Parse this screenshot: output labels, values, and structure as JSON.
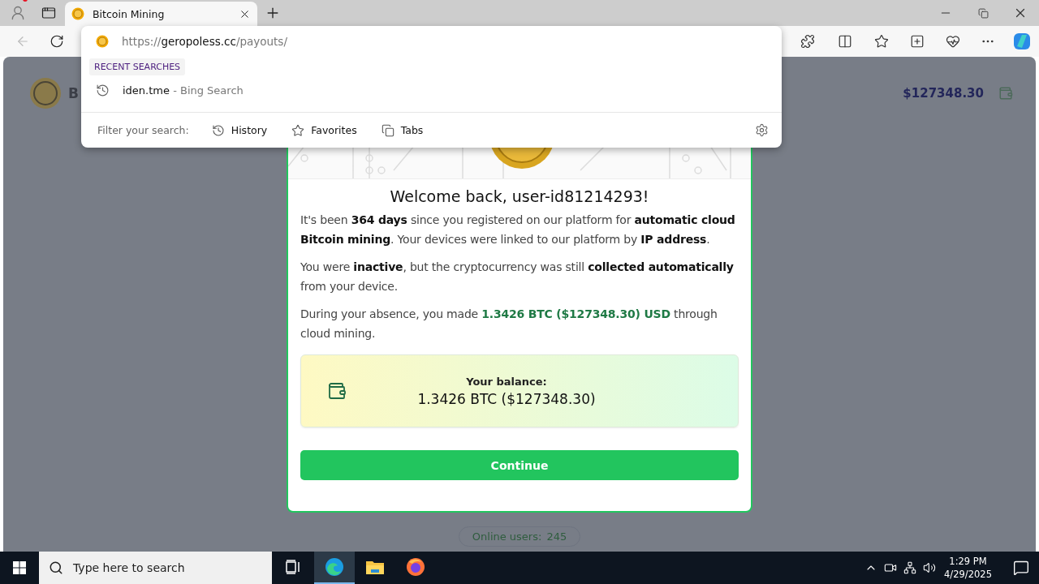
{
  "browser": {
    "tab": {
      "title": "Bitcoin Mining",
      "selected": true
    },
    "address": {
      "scheme": "https://",
      "host": "geropoless.cc",
      "path": "/payouts/"
    },
    "dropdown": {
      "section_label": "RECENT SEARCHES",
      "recent": [
        {
          "query": "iden.tme",
          "source": "- Bing Search"
        }
      ],
      "filter_label": "Filter your search:",
      "filters": [
        {
          "label": "History",
          "kind": "history"
        },
        {
          "label": "Favorites",
          "kind": "favorites"
        },
        {
          "label": "Tabs",
          "kind": "tabs"
        }
      ]
    }
  },
  "page": {
    "header": {
      "title": "B",
      "balance": "$127348.30"
    },
    "modal": {
      "title": "Welcome back, user-id81214293!",
      "paragraphs": [
        {
          "text": "It's been **364 days** since you registered on our platform for **automatic cloud Bitcoin mining**. Your devices were linked to our platform by **IP address**.",
          "kind": "dark"
        },
        {
          "text": "You were **inactive**, but the cryptocurrency was still **collected automatically** from your device.",
          "kind": "dark"
        },
        {
          "text": "During your absence, you made **1.3426 BTC ($127348.30) USD** through cloud mining.",
          "kind": "green"
        }
      ],
      "balance_label": "Your balance:",
      "balance_value": "1.3426 BTC ($127348.30)",
      "button": "Continue"
    },
    "online": {
      "label": "Online users:",
      "count": "245"
    }
  },
  "taskbar": {
    "search_placeholder": "Type here to search",
    "apps": [
      {
        "kind": "taskview",
        "selected": false
      },
      {
        "kind": "edge",
        "selected": true
      },
      {
        "kind": "explorer",
        "selected": false
      },
      {
        "kind": "firefox",
        "selected": false
      }
    ],
    "time": "1:29 PM",
    "date": "4/29/2025"
  }
}
